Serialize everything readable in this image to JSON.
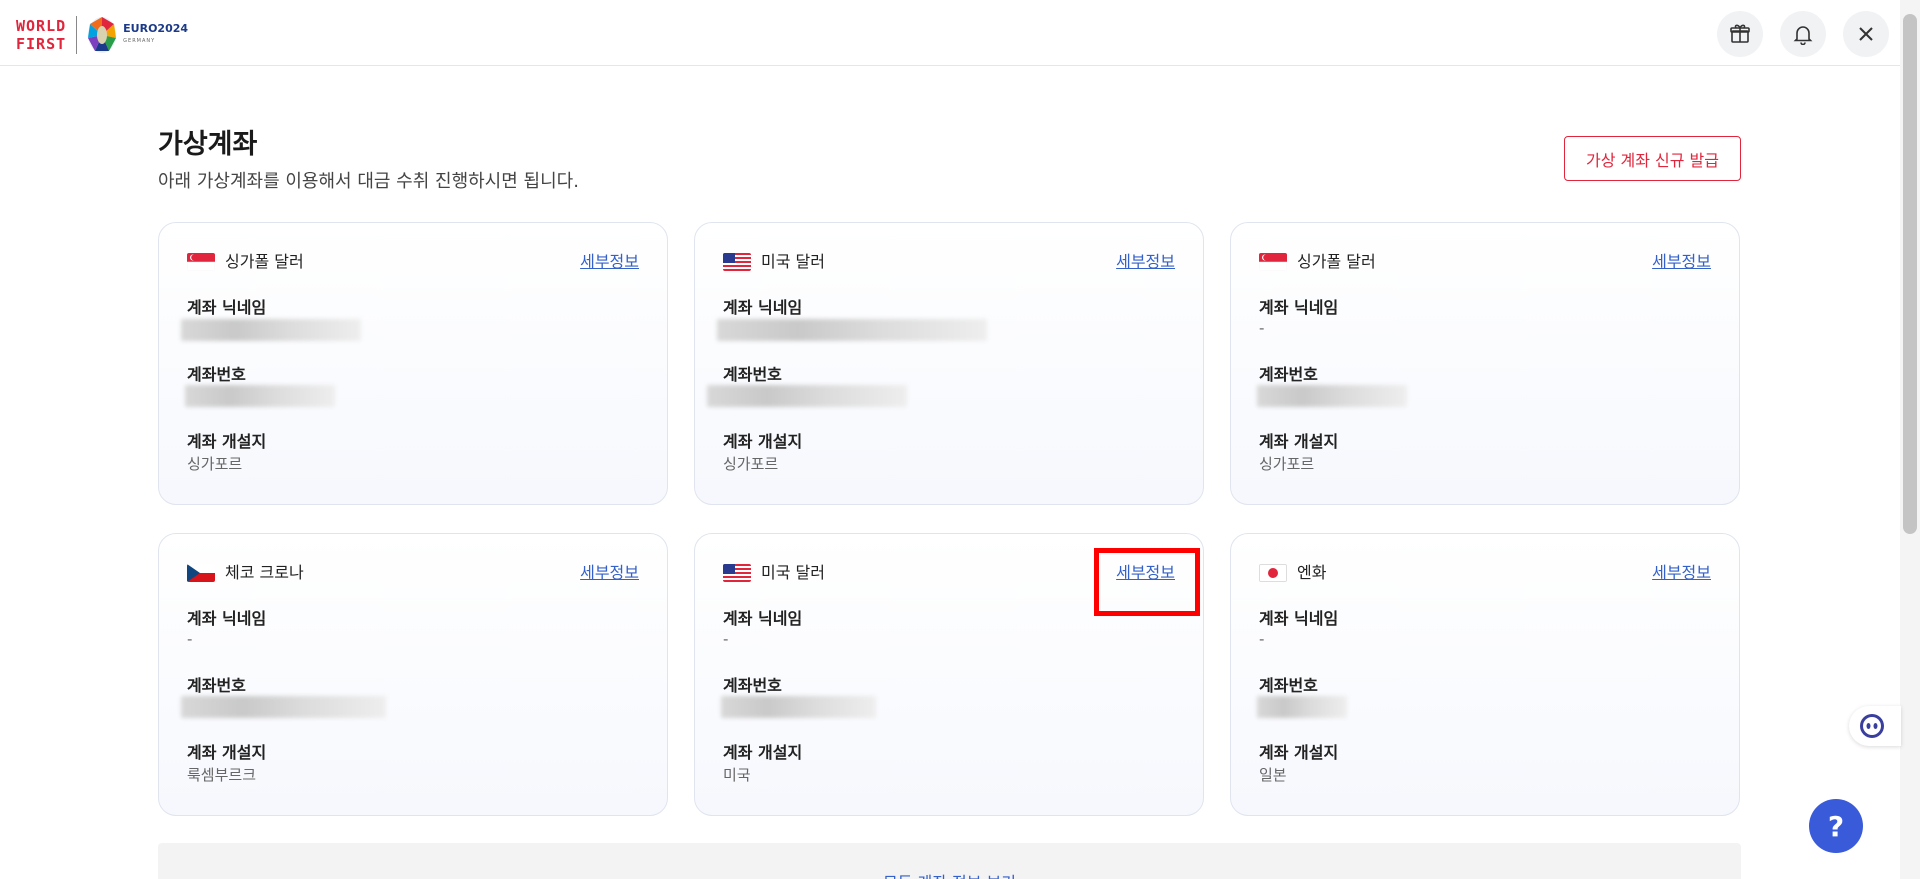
{
  "header": {
    "logo_line1": "WORLD",
    "logo_line2": "FIRST",
    "euro_title": "EURO2024",
    "euro_sub": "GERMANY"
  },
  "page": {
    "title": "가상계좌",
    "subtitle": "아래 가상계좌를 이용해서 대금 수취 진행하시면 됩니다.",
    "new_account_button": "가상 계좌 신규 발급"
  },
  "labels": {
    "nickname": "계좌 닉네임",
    "number": "계좌번호",
    "location": "계좌 개설지",
    "detail": "세부정보"
  },
  "cards": [
    {
      "flag": "sg-flag-icon",
      "currency": "싱가폴 달러",
      "nickname": "",
      "location": "싱가포르"
    },
    {
      "flag": "us-flag-icon",
      "currency": "미국 달러",
      "nickname": "",
      "location": "싱가포르"
    },
    {
      "flag": "sg-flag-icon",
      "currency": "싱가폴 달러",
      "nickname": "-",
      "location": "싱가포르"
    },
    {
      "flag": "cz-flag-icon",
      "currency": "체코 크로나",
      "nickname": "-",
      "location": "룩셈부르크"
    },
    {
      "flag": "us-flag-icon",
      "currency": "미국 달러",
      "nickname": "-",
      "location": "미국"
    },
    {
      "flag": "jp-flag-icon",
      "currency": "엔화",
      "nickname": "-",
      "location": "일본"
    }
  ],
  "bottom": {
    "view_all": "모든 계좌 정보 보기"
  },
  "help": {
    "label": "?"
  },
  "colors": {
    "brand_red": "#e1253c",
    "link_blue": "#3461c9",
    "help_blue": "#3a5bd9"
  }
}
